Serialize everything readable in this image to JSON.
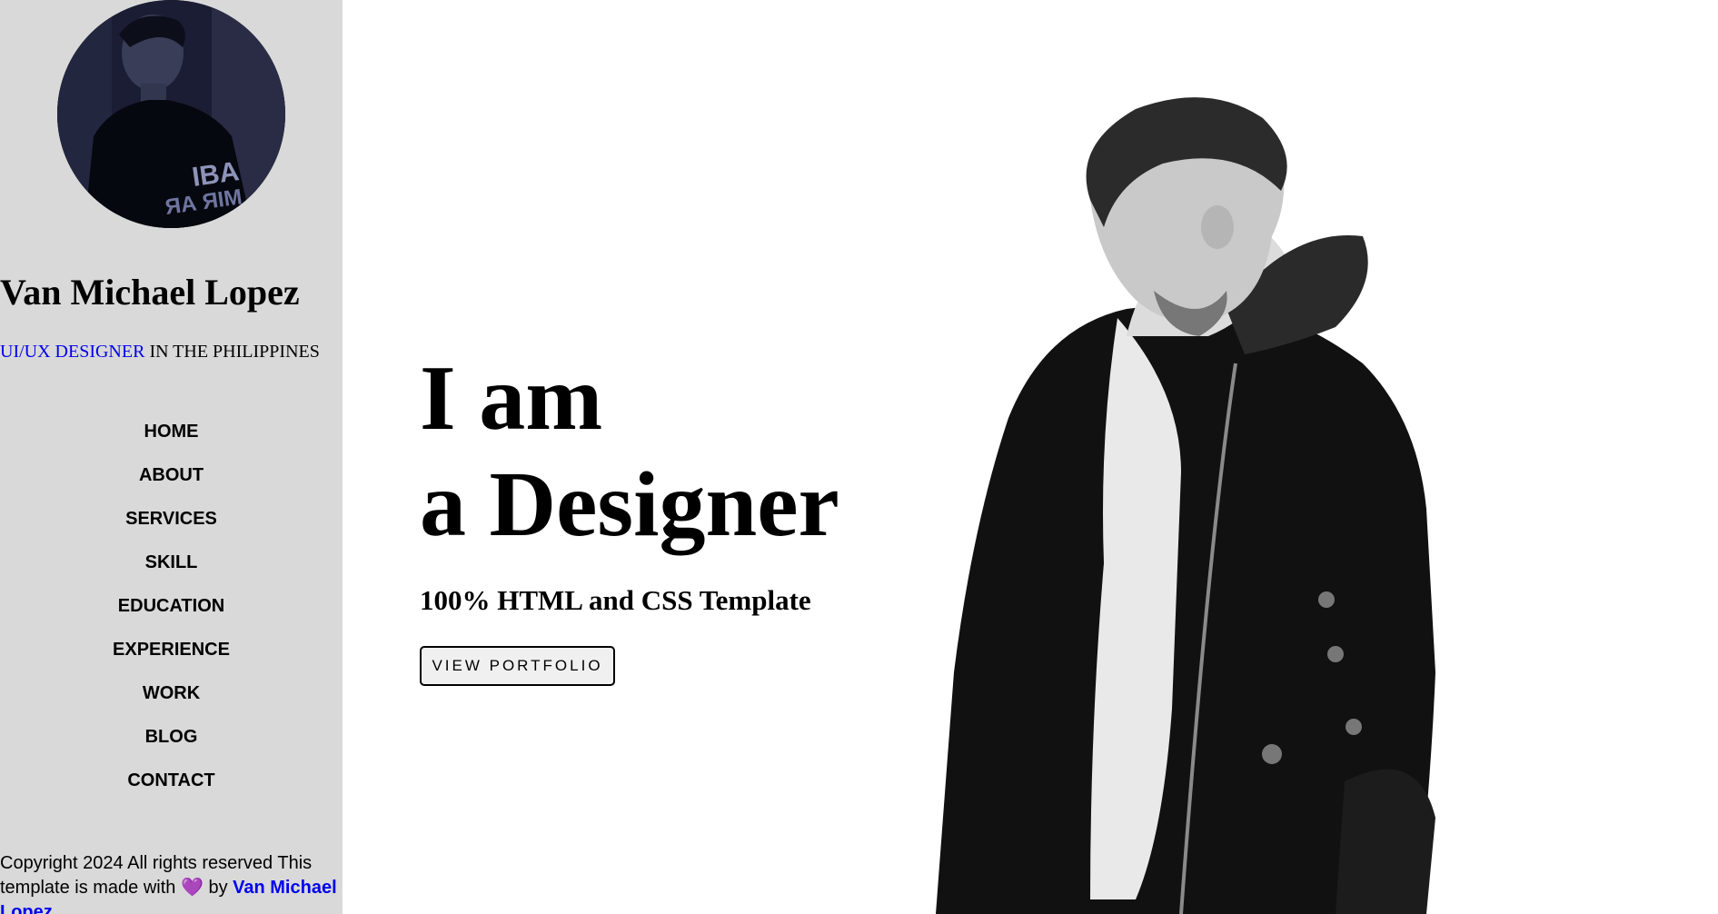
{
  "sidebar": {
    "name": "Van Michael Lopez",
    "role_highlight": "UI/UX DESIGNER",
    "role_rest": " IN THE PHILIPPINES",
    "nav": [
      {
        "label": "HOME"
      },
      {
        "label": "ABOUT"
      },
      {
        "label": "SERVICES"
      },
      {
        "label": "SKILL"
      },
      {
        "label": "EDUCATION"
      },
      {
        "label": "EXPERIENCE"
      },
      {
        "label": "WORK"
      },
      {
        "label": "BLOG"
      },
      {
        "label": "CONTACT"
      }
    ],
    "copyright_text": "Copyright 2024 All rights reserved This template is made with",
    "heart": "💜",
    "by_text": " by ",
    "author_link": "Van Michael Lopez"
  },
  "hero": {
    "line1": "I am",
    "line2": "a Designer",
    "subtitle": "100% HTML and CSS Template",
    "cta_label": "VIEW PORTFOLIO"
  },
  "colors": {
    "sidebar_bg": "#d9d9d9",
    "link": "#0000ee",
    "heart": "#8a4fd6"
  }
}
